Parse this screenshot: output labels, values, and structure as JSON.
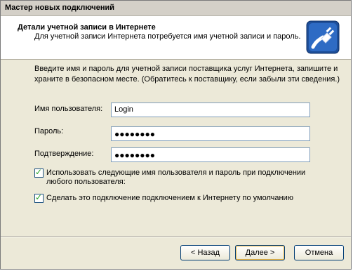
{
  "window": {
    "title": "Мастер новых подключений"
  },
  "header": {
    "title": "Детали учетной записи в Интернете",
    "subtitle": "Для учетной записи Интернета потребуется имя учетной записи и пароль.",
    "icon": "network-cable-icon"
  },
  "content": {
    "instructions": "Введите имя и пароль для учетной записи поставщика услуг Интернета, запишите и храните в безопасном месте. (Обратитесь к поставщику, если забыли эти сведения.)",
    "username": {
      "label": "Имя пользователя:",
      "value": "Login"
    },
    "password": {
      "label": "Пароль:",
      "value": "●●●●●●●●"
    },
    "confirm": {
      "label": "Подтверждение:",
      "value": "●●●●●●●●"
    },
    "checkbox_all_users": {
      "label": "Использовать следующие имя пользователя и пароль при подключении любого пользователя:",
      "checked": true
    },
    "checkbox_default": {
      "label": "Сделать это подключение подключением к Интернету по умолчанию",
      "checked": true
    }
  },
  "buttons": {
    "back": "< Назад",
    "next": "Далее >",
    "cancel": "Отмена"
  },
  "colors": {
    "accent": "#003c74",
    "checkmark": "#21a121",
    "dialog_bg": "#ece9d8"
  }
}
